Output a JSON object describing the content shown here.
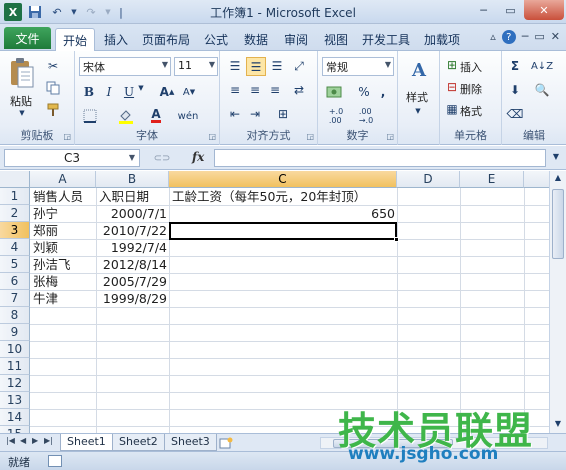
{
  "window": {
    "title": "工作簿1 - Microsoft Excel"
  },
  "qat": {
    "logo": "X",
    "save_icon": "save-icon",
    "undo_icon": "undo-icon",
    "redo_icon": "redo-icon"
  },
  "tabs": [
    {
      "label": "文件"
    },
    {
      "label": "开始"
    },
    {
      "label": "插入"
    },
    {
      "label": "页面布局"
    },
    {
      "label": "公式"
    },
    {
      "label": "数据"
    },
    {
      "label": "审阅"
    },
    {
      "label": "视图"
    },
    {
      "label": "开发工具"
    },
    {
      "label": "加载项"
    }
  ],
  "ribbon": {
    "clipboard": {
      "label": "剪贴板",
      "paste": "粘贴"
    },
    "font": {
      "label": "字体",
      "font_name": "宋体",
      "font_size": "11"
    },
    "alignment": {
      "label": "对齐方式"
    },
    "number": {
      "label": "数字",
      "format": "常规",
      "percent": "%",
      "comma": ","
    },
    "styles": {
      "label": "样式"
    },
    "cells": {
      "label": "单元格",
      "insert": "插入",
      "delete": "删除",
      "format": "格式"
    },
    "editing": {
      "label": "编辑"
    }
  },
  "formula_bar": {
    "name_box": "C3",
    "fx": "fx",
    "formula": ""
  },
  "grid": {
    "columns": [
      "A",
      "B",
      "C",
      "D",
      "E"
    ],
    "rows": [
      "1",
      "2",
      "3",
      "4",
      "5",
      "6",
      "7",
      "8",
      "9",
      "10",
      "11",
      "12",
      "13",
      "14",
      "15"
    ],
    "cells": {
      "A1": "销售人员",
      "B1": "入职日期",
      "C1": "工龄工资（每年50元，20年封顶）",
      "A2": "孙宁",
      "B2": "2000/7/1",
      "C2": "650",
      "A3": "郑丽",
      "B3": "2010/7/22",
      "A4": "刘颖",
      "B4": "1992/7/4",
      "A5": "孙洁飞",
      "B5": "2012/8/14",
      "A6": "张梅",
      "B6": "2005/7/29",
      "A7": "牛津",
      "B7": "1999/8/29"
    },
    "selected": "C3"
  },
  "sheets": [
    {
      "label": "Sheet1"
    },
    {
      "label": "Sheet2"
    },
    {
      "label": "Sheet3"
    }
  ],
  "status": {
    "text": "就绪"
  },
  "watermark": {
    "line1": "技术员联盟",
    "line2": "www.jsgho.com"
  },
  "colors": {
    "excel_green": "#1e7145",
    "selection_header": "#f1c15f",
    "ribbon_blue": "#dfe8f4"
  }
}
